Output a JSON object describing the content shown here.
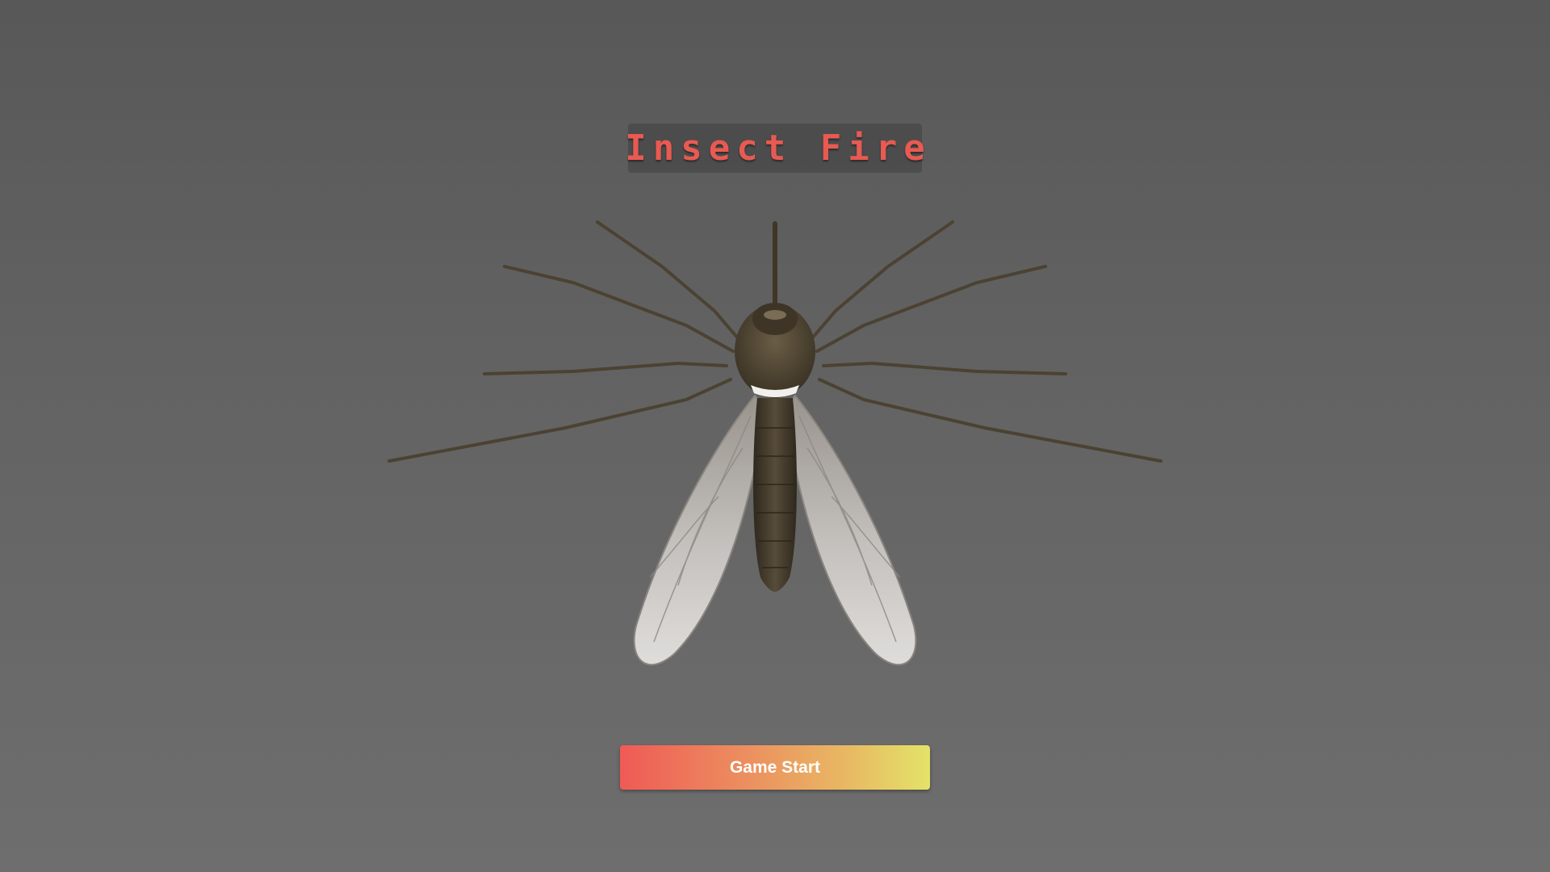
{
  "title": {
    "text": "Insect Fire",
    "color": "#e85a52"
  },
  "insect": {
    "icon": "mosquito-icon"
  },
  "start_button": {
    "label": "Game Start",
    "gradient_start": "#ef5a55",
    "gradient_end": "#e3e369"
  },
  "colors": {
    "background": "#636363",
    "title_box": "#454545"
  }
}
